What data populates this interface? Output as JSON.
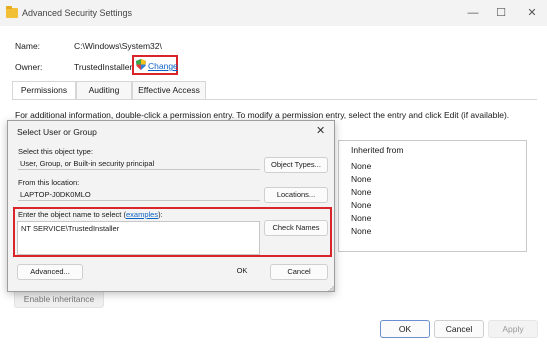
{
  "window": {
    "title": "Advanced Security Settings",
    "controls": {
      "minimize": "—",
      "maximize": "☐",
      "close": "✕"
    }
  },
  "security": {
    "name_label": "Name:",
    "name_value": "C:\\Windows\\System32\\",
    "owner_label": "Owner:",
    "owner_value": "TrustedInstaller",
    "change_link": "Change"
  },
  "tabs": [
    {
      "label": "Permissions",
      "active": true
    },
    {
      "label": "Auditing",
      "active": false
    },
    {
      "label": "Effective Access",
      "active": false
    }
  ],
  "info_text": "For additional information, double-click a permission entry. To modify a permission entry, select the entry and click Edit (if available).",
  "permission_list": {
    "header": "Inherited from",
    "items": [
      "None",
      "None",
      "None",
      "None",
      "None",
      "None"
    ]
  },
  "main_buttons": {
    "enable_inheritance": "Enable inheritance",
    "ok": "OK",
    "cancel": "Cancel",
    "apply": "Apply"
  },
  "dialog": {
    "title": "Select User or Group",
    "close": "✕",
    "object_type_label": "Select this object type:",
    "object_type_value": "User, Group, or Built-in security principal",
    "object_types_button": "Object Types...",
    "location_label": "From this location:",
    "location_value": "LAPTOP-J0DK0MLO",
    "locations_button": "Locations...",
    "enter_name_label": "Enter the object name to select (",
    "examples_link": "examples",
    "enter_name_suffix": "):",
    "object_name_value": "NT SERVICE\\TrustedInstaller",
    "check_names_button": "Check Names",
    "advanced_button": "Advanced...",
    "ok_button": "OK",
    "cancel_button": "Cancel"
  },
  "colors": {
    "highlight": "#d9252a",
    "link": "#0b62c4",
    "dialog_bg": "#f3f3f3"
  }
}
